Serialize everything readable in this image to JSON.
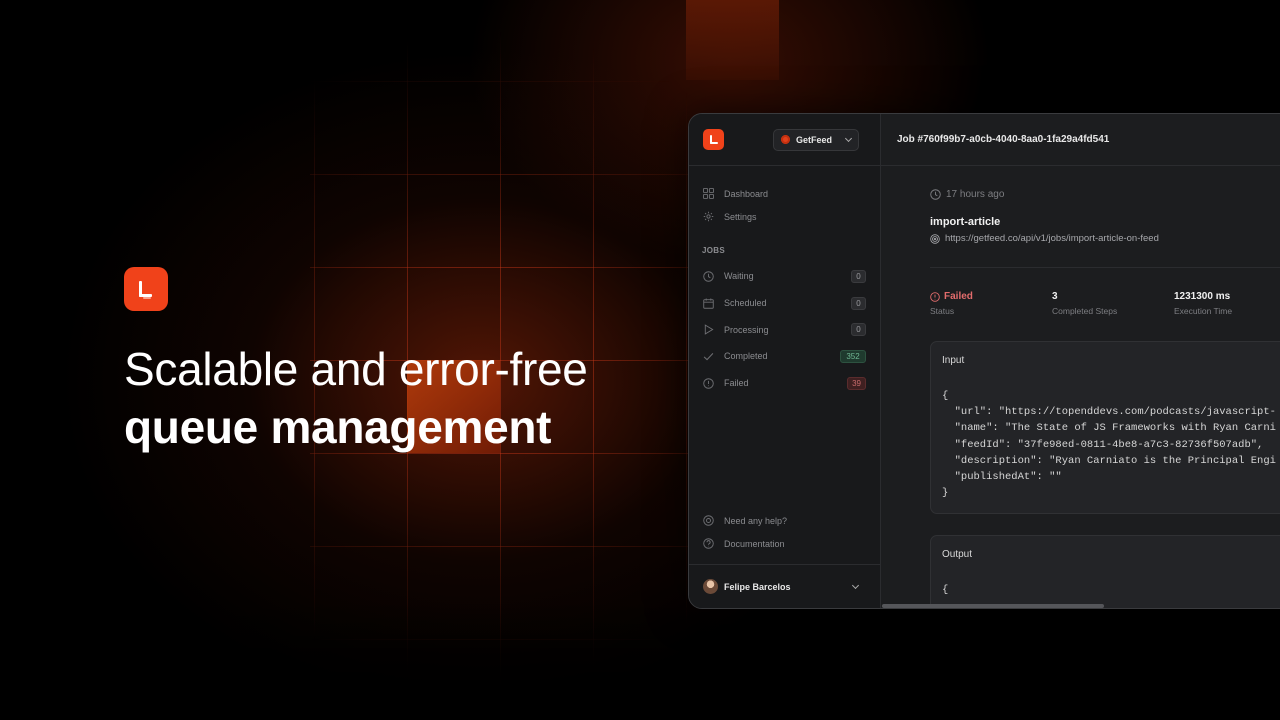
{
  "hero": {
    "title_line1": "Scalable and error-free",
    "title_line2": "queue management"
  },
  "sidebar": {
    "project": "GetFeed",
    "nav": [
      {
        "label": "Dashboard",
        "icon": "grid-icon"
      },
      {
        "label": "Settings",
        "icon": "gear-icon"
      }
    ],
    "jobs_section": "JOBS",
    "jobs": [
      {
        "label": "Waiting",
        "count": "0",
        "icon": "clock-icon"
      },
      {
        "label": "Scheduled",
        "count": "0",
        "icon": "calendar-icon"
      },
      {
        "label": "Processing",
        "count": "0",
        "icon": "play-icon"
      },
      {
        "label": "Completed",
        "count": "352",
        "icon": "check-icon"
      },
      {
        "label": "Failed",
        "count": "39",
        "icon": "alert-icon"
      }
    ],
    "help": [
      {
        "label": "Need any help?",
        "icon": "help-circle-icon"
      },
      {
        "label": "Documentation",
        "icon": "question-icon"
      }
    ],
    "user": "Felipe Barcelos"
  },
  "main": {
    "job_title": "Job #760f99b7-a0cb-4040-8aa0-1fa29a4fd541",
    "time_ago": "17 hours ago",
    "job_name": "import-article",
    "job_url": "https://getfeed.co/api/v1/jobs/import-article-on-feed",
    "stats": [
      {
        "value": "Failed",
        "label": "Status"
      },
      {
        "value": "3",
        "label": "Completed Steps"
      },
      {
        "value": "1231300 ms",
        "label": "Execution Time"
      }
    ],
    "input_title": "Input",
    "input_code": "{\n  \"url\": \"https://topenddevs.com/podcasts/javascript-\n  \"name\": \"The State of JS Frameworks with Ryan Carni\n  \"feedId\": \"37fe98ed-0811-4be8-a7c3-82736f507adb\",\n  \"description\": \"Ryan Carniato is the Principal Engi\n  \"publishedAt\": \"\"\n}",
    "output_title": "Output",
    "output_code": "{"
  },
  "colors": {
    "brand": "#f0421a",
    "failed": "#e26c6c",
    "completed_badge": "#6fb592"
  }
}
